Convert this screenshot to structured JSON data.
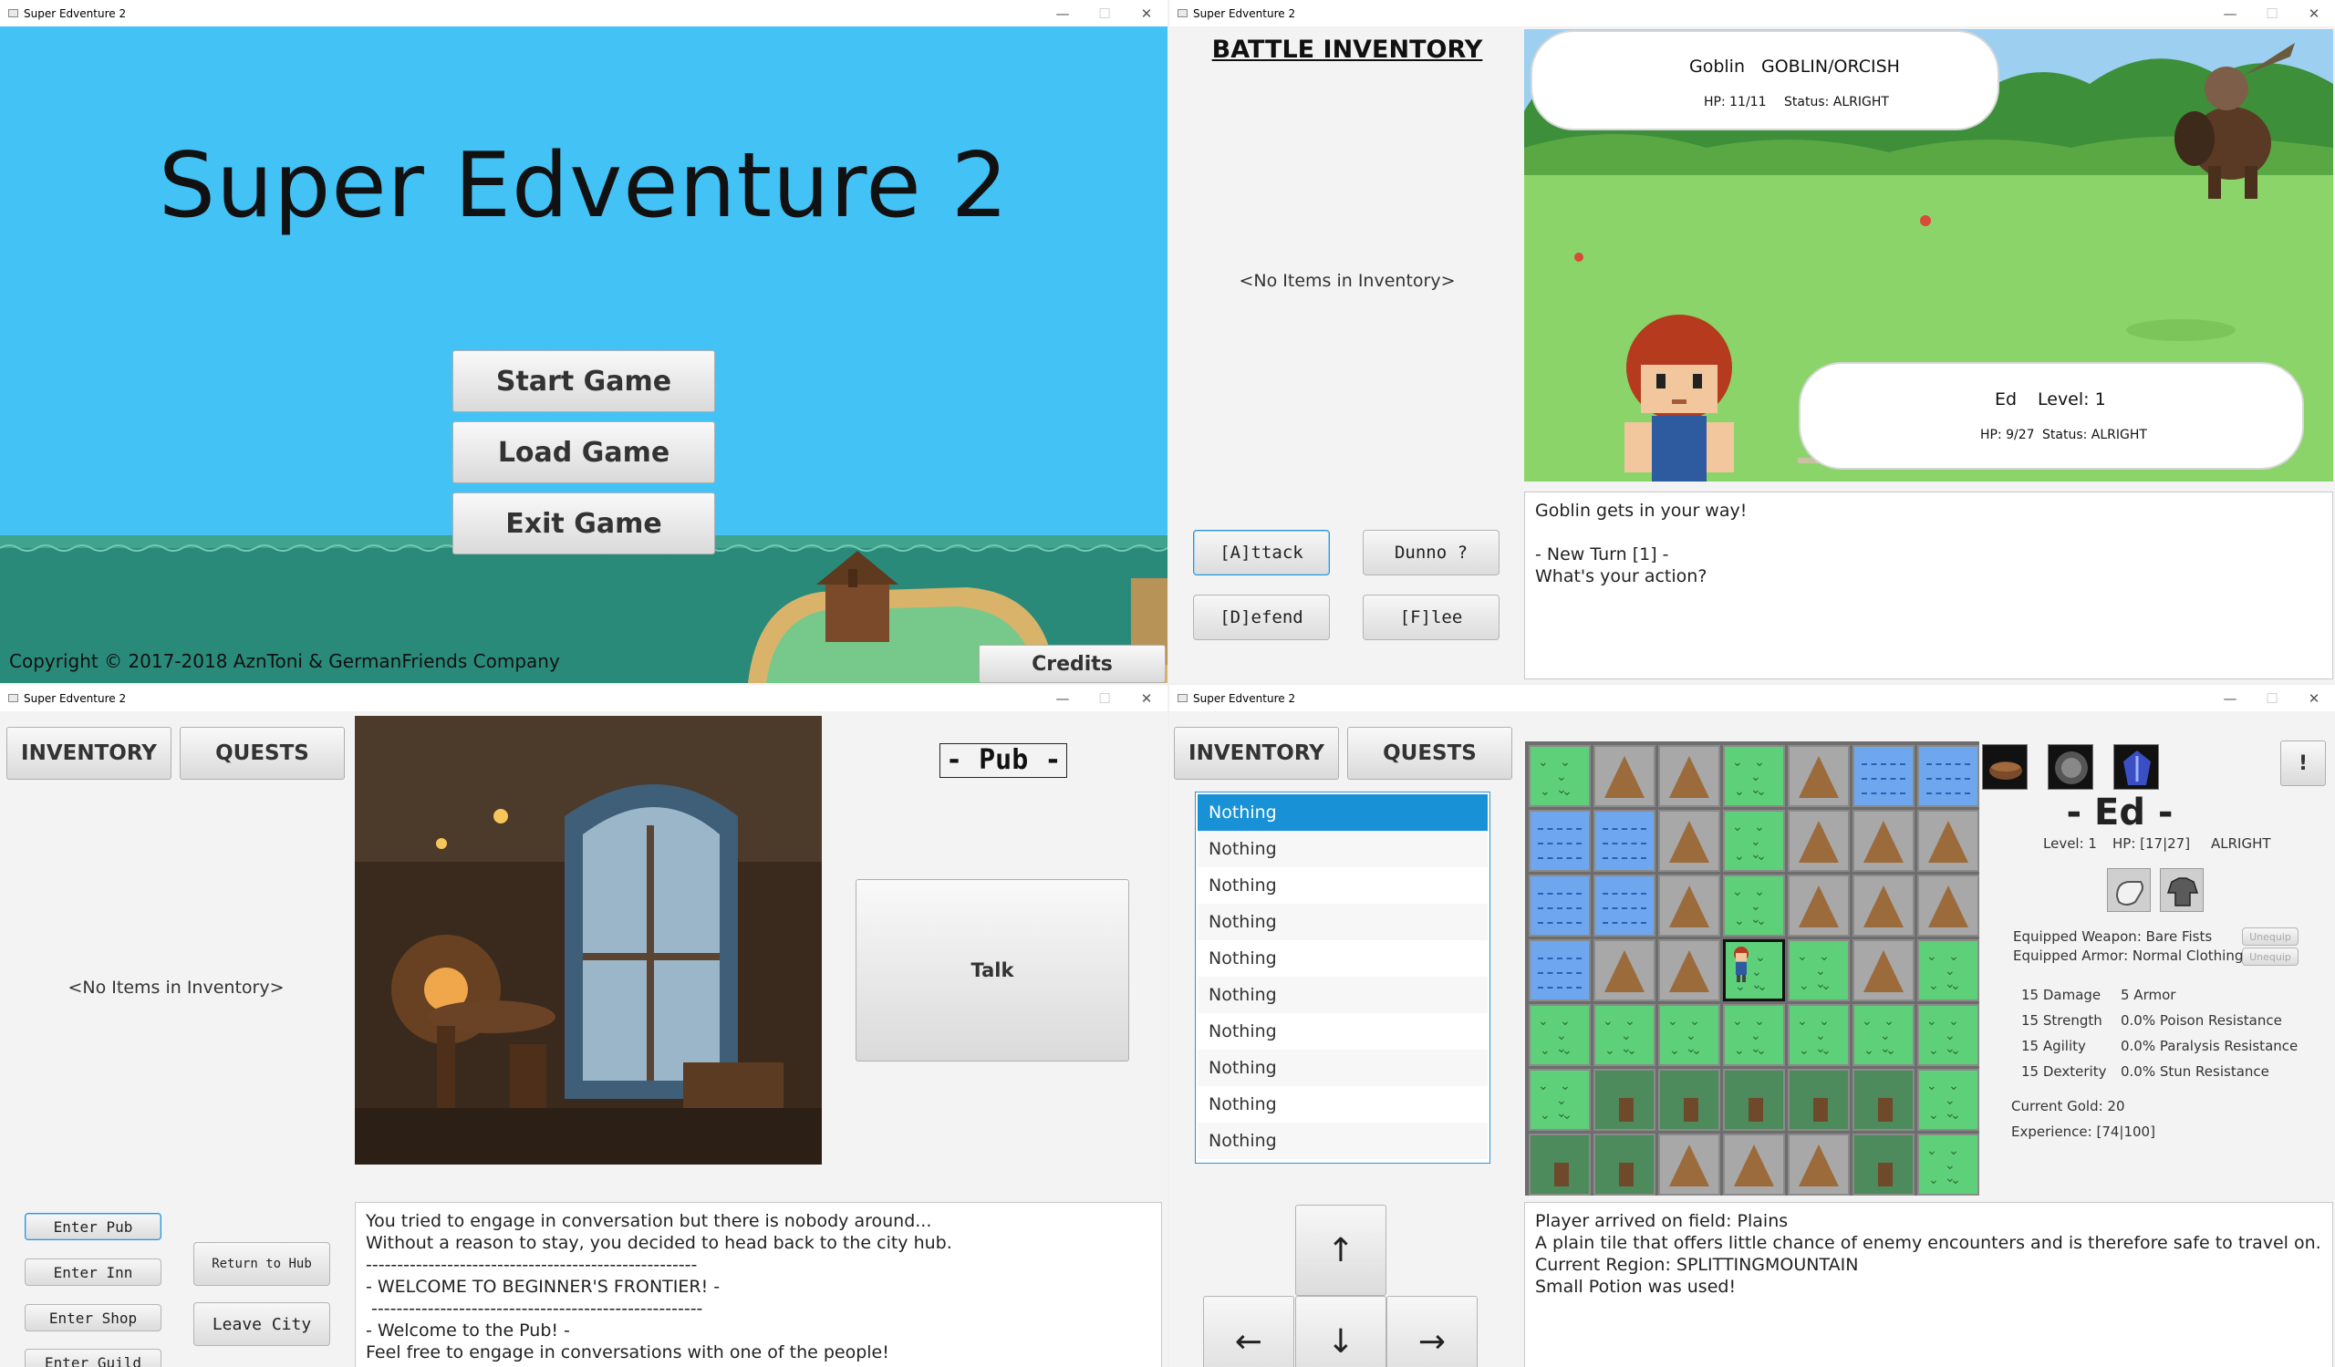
{
  "window_title": "Super Edventure 2",
  "window_controls": {
    "minimize": "—",
    "maximize": "☐",
    "close": "✕"
  },
  "main_menu": {
    "game_title": "Super Edventure 2",
    "start_label": "Start Game",
    "load_label": "Load Game",
    "exit_label": "Exit Game",
    "copyright": "Copyright © 2017-2018 AznToni & GermanFriends Company",
    "credits_label": "Credits",
    "colors": {
      "sky": "#43c2f5",
      "sea": "#2a8a7a"
    }
  },
  "battle": {
    "inventory_title": "BATTLE INVENTORY",
    "inventory_empty": "<No Items in Inventory>",
    "enemy": {
      "name": "Goblin",
      "race": "GOBLIN/ORCISH",
      "hp": "HP: 11/11",
      "status": "Status: ALRIGHT"
    },
    "player": {
      "name": "Ed",
      "level": "Level: 1",
      "hp": "HP: 9/27",
      "status": "Status: ALRIGHT"
    },
    "actions": {
      "attack": "[A]ttack",
      "dunno": "Dunno ?",
      "defend": "[D]efend",
      "flee": "[F]lee"
    },
    "log": "Goblin gets in your way!\n\n- New Turn [1] -\nWhat's your action?"
  },
  "pub": {
    "inventory_label": "INVENTORY",
    "quests_label": "QUESTS",
    "inventory_empty": "<No Items in Inventory>",
    "location_title": "- Pub -",
    "talk_label": "Talk",
    "enter_pub": "Enter Pub",
    "enter_inn": "Enter Inn",
    "enter_shop": "Enter Shop",
    "enter_guild": "Enter Guild",
    "return_hub": "Return to Hub",
    "leave_city": "Leave City",
    "log": "You tried to engage in conversation but there is nobody around...\nWithout a reason to stay, you decided to head back to the city hub.\n-----------------------------------------------------\n- WELCOME TO BEGINNER'S FRONTIER! -\n -----------------------------------------------------\n- Welcome to the Pub! -\nFeel free to engage in conversations with one of the people!"
  },
  "world": {
    "inventory_label": "INVENTORY",
    "quests_label": "QUESTS",
    "inventory_items": [
      "Nothing",
      "Nothing",
      "Nothing",
      "Nothing",
      "Nothing",
      "Nothing",
      "Nothing",
      "Nothing",
      "Nothing",
      "Nothing"
    ],
    "arrows": {
      "up": "↑",
      "left": "←",
      "down": "↓",
      "right": "→"
    },
    "map_rows": [
      [
        "g",
        "m",
        "m",
        "g",
        "m",
        "w",
        "w"
      ],
      [
        "w",
        "w",
        "m",
        "g",
        "m",
        "m",
        "m"
      ],
      [
        "w",
        "w",
        "m",
        "g",
        "m",
        "m",
        "m"
      ],
      [
        "w",
        "m",
        "m",
        "p",
        "g",
        "m",
        "g"
      ],
      [
        "g",
        "g",
        "g",
        "g",
        "g",
        "g",
        "g"
      ],
      [
        "g",
        "f",
        "f",
        "f",
        "f",
        "f",
        "g"
      ],
      [
        "f",
        "f",
        "m",
        "m",
        "m",
        "f",
        "g"
      ]
    ],
    "alert_label": "!",
    "char_name": "- Ed -",
    "level": "Level: 1",
    "hp": "HP: [17|27]",
    "status": "ALRIGHT",
    "weapon": "Equipped Weapon: Bare Fists",
    "armor": "Equipped Armor: Normal Clothing",
    "unequip_label": "Unequip",
    "stats_left": [
      "15 Damage",
      "15 Strength",
      "15 Agility",
      "15 Dexterity"
    ],
    "stats_right": [
      "5 Armor",
      "0.0% Poison Resistance",
      "0.0% Paralysis Resistance",
      "0.0% Stun Resistance"
    ],
    "gold": "Current Gold: 20",
    "experience": "Experience: [74|100]",
    "log": "Player arrived on field: Plains\nA plain tile that offers little chance of enemy encounters and is therefore safe to travel on.\nCurrent Region: SPLITTINGMOUNTAIN\nSmall Potion was used!"
  }
}
